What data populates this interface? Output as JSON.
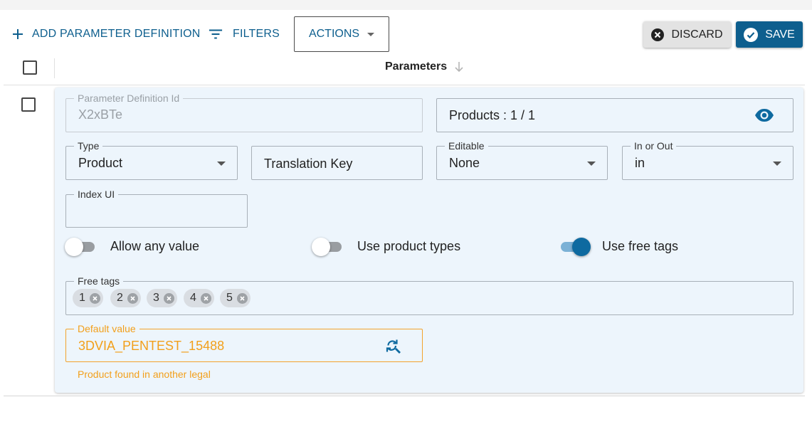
{
  "toolbar": {
    "add_label": "ADD PARAMETER DEFINITION",
    "filters_label": "FILTERS",
    "actions_label": "ACTIONS",
    "discard_label": "DISCARD",
    "save_label": "SAVE"
  },
  "table": {
    "column_header": "Parameters"
  },
  "row": {
    "parameter_definition_id": {
      "label": "Parameter Definition Id",
      "value": "X2xBTe"
    },
    "products": {
      "value": "Products : 1 / 1"
    },
    "type": {
      "label": "Type",
      "value": "Product"
    },
    "translation_key": {
      "placeholder": "Translation Key"
    },
    "editable": {
      "label": "Editable",
      "value": "None"
    },
    "in_or_out": {
      "label": "In or Out",
      "value": "in"
    },
    "index_ui": {
      "label": "Index UI",
      "value": ""
    },
    "toggles": [
      {
        "label": "Allow any value",
        "on": false
      },
      {
        "label": "Use product types",
        "on": false
      },
      {
        "label": "Use free tags",
        "on": true
      }
    ],
    "free_tags": {
      "label": "Free tags",
      "tags": [
        "1",
        "2",
        "3",
        "4",
        "5"
      ]
    },
    "default_value": {
      "label": "Default value",
      "value": "3DVIA_PENTEST_15488",
      "helper": "Product found in another legal"
    }
  },
  "colors": {
    "accent": "#0e5f8e",
    "warning": "#f29f1a",
    "card_background": "#edf5fc"
  },
  "icons": [
    "plus-icon",
    "filter-icon",
    "caret-down-icon",
    "close-circle-icon",
    "check-circle-icon",
    "sort-arrow-icon",
    "eye-icon",
    "refresh-search-icon",
    "chip-remove-icon"
  ]
}
